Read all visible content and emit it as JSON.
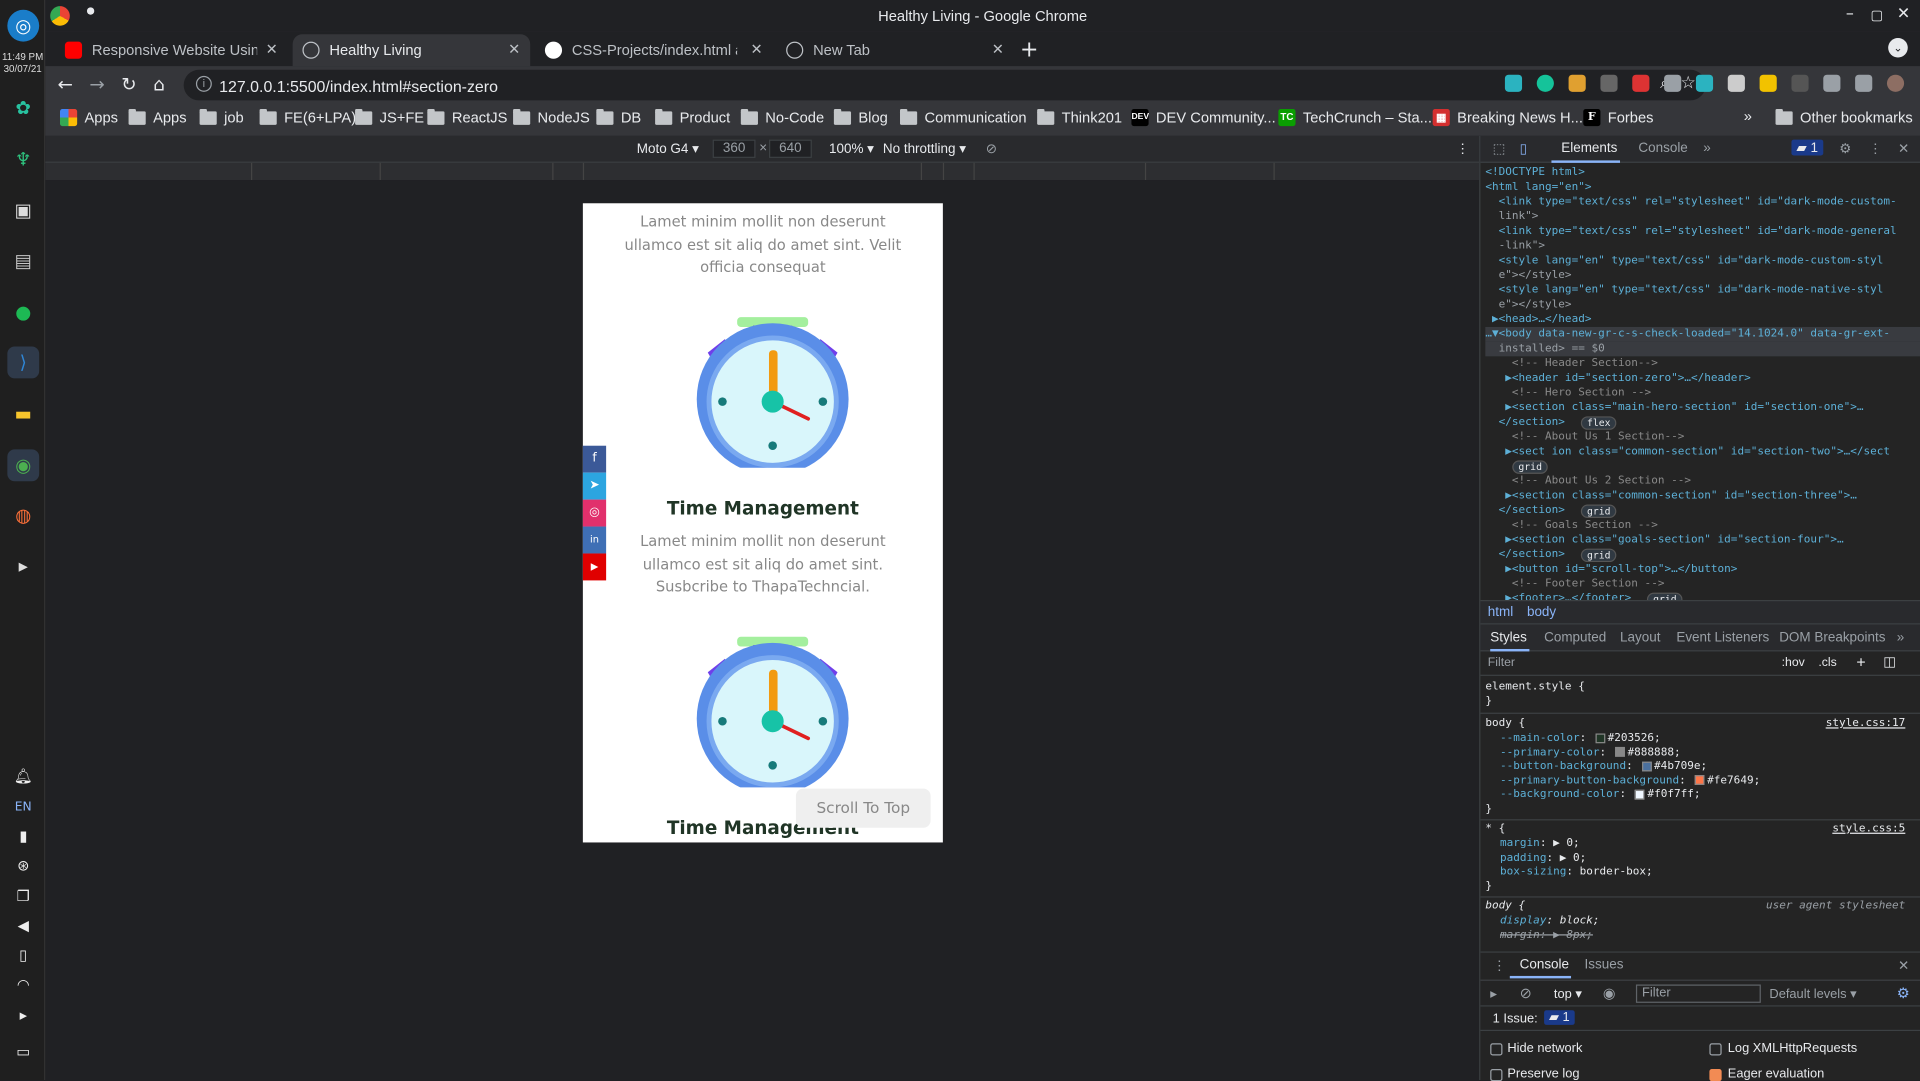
{
  "os": {
    "clock_time": "11:49 PM",
    "clock_date": "30/07/21",
    "lang": "EN",
    "dock_icons": [
      "ubuntu-icon",
      "app-green-icon",
      "app-green2-icon",
      "download-icon",
      "files-icon",
      "spotify-icon",
      "vscode-icon",
      "notes-icon",
      "chrome-icon",
      "firefox-icon",
      "terminal-icon"
    ],
    "tray_icons": [
      "bell-icon",
      "lang",
      "battery-icon",
      "network-icon",
      "clipboard-icon",
      "volume-icon",
      "power-icon",
      "wifi-icon",
      "chevron-icon",
      "desktop-icon"
    ]
  },
  "window": {
    "title": "Healthy Living - Google Chrome"
  },
  "tabs": [
    {
      "label": "Responsive Website Using",
      "fav": "#ff0000"
    },
    {
      "label": "Healthy Living",
      "fav": "#9aa0a6"
    },
    {
      "label": "CSS-Projects/index.html at m",
      "fav": "#ffffff"
    },
    {
      "label": "New Tab",
      "fav": "#9aa0a6"
    }
  ],
  "address": {
    "url": "127.0.0.1:5500/index.html#section-zero"
  },
  "bookmarks": [
    {
      "label": "Apps",
      "type": "apps"
    },
    {
      "label": "Apps",
      "type": "folder"
    },
    {
      "label": "job",
      "type": "folder"
    },
    {
      "label": "FE(6+LPA)",
      "type": "folder"
    },
    {
      "label": "JS+FE",
      "type": "folder"
    },
    {
      "label": "ReactJS",
      "type": "folder"
    },
    {
      "label": "NodeJS",
      "type": "folder"
    },
    {
      "label": "DB",
      "type": "folder"
    },
    {
      "label": "Product",
      "type": "folder"
    },
    {
      "label": "No-Code",
      "type": "folder"
    },
    {
      "label": "Blog",
      "type": "folder"
    },
    {
      "label": "Communication",
      "type": "folder"
    },
    {
      "label": "Think201",
      "type": "folder"
    },
    {
      "label": "DEV Community...",
      "type": "dev"
    },
    {
      "label": "TechCrunch – Sta...",
      "type": "tc"
    },
    {
      "label": "Breaking News H...",
      "type": "bn"
    },
    {
      "label": "Forbes",
      "type": "forbes"
    }
  ],
  "other_bookmarks": "Other bookmarks",
  "device_toolbar": {
    "device": "Moto G4",
    "width": "360",
    "height": "640",
    "zoom": "100%",
    "throttle": "No throttling"
  },
  "site": {
    "para1": "Lamet minim mollit non deserunt ullamco est sit aliq do amet sint. Velit officia consequat",
    "heading1": "Time Management",
    "para2": "Lamet minim mollit non deserunt ullamco est sit aliq do amet sint. Susbcribe to ThapaTechncial.",
    "heading2": "Time Management",
    "scroll_top": "Scroll To Top",
    "social": [
      {
        "name": "facebook-icon",
        "glyph": "f",
        "color": "#3b5998"
      },
      {
        "name": "telegram-icon",
        "glyph": "➤",
        "color": "#2ca5e0"
      },
      {
        "name": "instagram-icon",
        "glyph": "◎",
        "color": "#e1306c"
      },
      {
        "name": "linkedin-icon",
        "glyph": "in",
        "color": "#3f6fb5"
      },
      {
        "name": "youtube-icon",
        "glyph": "▶",
        "color": "#e00000"
      }
    ]
  },
  "devtools": {
    "tab_elements": "Elements",
    "tab_console": "Console",
    "issues_count": "1",
    "dom": [
      "<!DOCTYPE html>",
      "<html lang=\"en\">",
      "  <link type=\"text/css\" rel=\"stylesheet\" id=\"dark-mode-custom-",
      "  link\">",
      "  <link type=\"text/css\" rel=\"stylesheet\" id=\"dark-mode-general",
      "  -link\">",
      "  <style lang=\"en\" type=\"text/css\" id=\"dark-mode-custom-styl",
      "  e\"></style>",
      "  <style lang=\"en\" type=\"text/css\" id=\"dark-mode-native-styl",
      "  e\"></style>",
      " ▶<head>…</head>",
      "…▼<body data-new-gr-c-s-check-loaded=\"14.1024.0\" data-gr-ext-",
      "  installed> == $0",
      "    <!-- Header Section-->",
      "   ▶<header id=\"section-zero\">…</header>",
      "    <!-- Hero Section -->",
      "   ▶<section class=\"main-hero-section\" id=\"section-one\">…",
      "  </section>",
      "    <!-- About Us 1 Section-->",
      "   ▶<sect ion class=\"common-section\" id=\"section-two\">…</sect",
      "  ",
      "    <!-- About Us 2 Section -->",
      "   ▶<section class=\"common-section\" id=\"section-three\">…",
      "  </section>",
      "    <!-- Goals Section -->",
      "   ▶<section class=\"goals-section\" id=\"section-four\">…",
      "  </section>",
      "   ▶<button id=\"scroll-top\">…</button>",
      "    <!-- Footer Section -->",
      "   ▶<footer>…</footer>"
    ],
    "badges": [
      "flex",
      "grid",
      "grid",
      "grid",
      "grid"
    ],
    "crumb_html": "html",
    "crumb_body": "body",
    "style_tabs": [
      "Styles",
      "Computed",
      "Layout",
      "Event Listeners",
      "DOM Breakpoints"
    ],
    "filter_placeholder": "Filter",
    "hov": ":hov",
    "cls": ".cls",
    "styles": {
      "element_style": "element.style {",
      "close": "}",
      "body_selector": "body {",
      "body_src": "style.css:17",
      "vars": [
        {
          "prop": "--main-color",
          "value": "#203526;",
          "color": "#203526"
        },
        {
          "prop": "--primary-color",
          "value": "#888888;",
          "color": "#888888"
        },
        {
          "prop": "--button-background",
          "value": "#4b709e;",
          "color": "#4b709e"
        },
        {
          "prop": "--primary-button-background",
          "value": "#fe7649;",
          "color": "#fe7649"
        },
        {
          "prop": "--background-color",
          "value": "#f0f7ff;",
          "color": "#f0f7ff"
        }
      ],
      "star_selector": "* {",
      "star_src": "style.css:5",
      "star_props": [
        {
          "prop": "margin",
          "value": "▶ 0;"
        },
        {
          "prop": "padding",
          "value": "▶ 0;"
        },
        {
          "prop": "box-sizing",
          "value": "border-box;"
        }
      ],
      "ua_selector": "body {",
      "ua_src": "user agent stylesheet",
      "ua_props": [
        {
          "prop": "display",
          "value": "block;"
        },
        {
          "prop": "margin",
          "value": "▶ 8px;"
        }
      ]
    },
    "drawer": {
      "tab_console": "Console",
      "tab_issues": "Issues",
      "context": "top",
      "filter_placeholder": "Filter",
      "levels": "Default levels",
      "issues_label": "1 Issue:",
      "issues_count": "1",
      "hide_network": "Hide network",
      "log_xhr": "Log XMLHttpRequests",
      "preserve_log": "Preserve log",
      "eager_eval": "Eager evaluation"
    }
  }
}
